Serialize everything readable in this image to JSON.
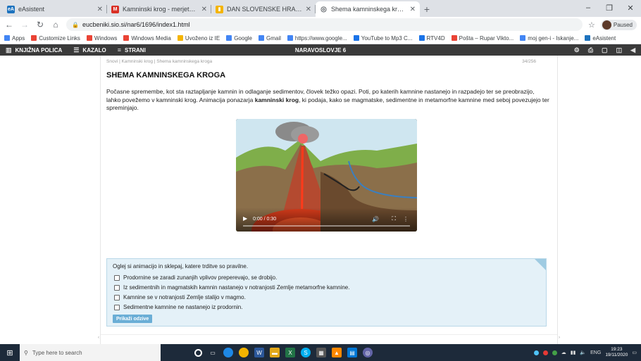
{
  "browser": {
    "tabs": [
      {
        "title": "eAsistent",
        "favicon_text": "eA",
        "favicon_color": "#1e73be",
        "active": false
      },
      {
        "title": "Kamninski krog - merjetka.rupar@",
        "favicon_text": "M",
        "favicon_color": "#d93025",
        "active": false
      },
      {
        "title": "DAN SLOVENSKE HRANE IN TRA",
        "favicon_text": "▮",
        "favicon_color": "#f4b400",
        "active": false
      },
      {
        "title": "Shema kamninskega kroga",
        "favicon_text": "◎",
        "favicon_color": "#5f6368",
        "active": true
      }
    ],
    "new_tab": "+",
    "window_controls": [
      "–",
      "❐",
      "✕"
    ],
    "address": "eucbeniki.sio.si/nar6/1696/index1.html",
    "profile_label": "Paused",
    "bookmarks": [
      {
        "label": "Apps",
        "color": "#4285f4"
      },
      {
        "label": "Customize Links",
        "color": "#ea4335"
      },
      {
        "label": "Windows",
        "color": "#ea4335"
      },
      {
        "label": "Windows Media",
        "color": "#ea4335"
      },
      {
        "label": "Uvoženo iz IE",
        "color": "#f4b400"
      },
      {
        "label": "Google",
        "color": "#4285f4"
      },
      {
        "label": "Gmail",
        "color": "#4285f4"
      },
      {
        "label": "https://www.google...",
        "color": "#4285f4"
      },
      {
        "label": "YouTube to Mp3 C...",
        "color": "#1a73e8"
      },
      {
        "label": "RTV4D",
        "color": "#1a73e8"
      },
      {
        "label": "Pošta – Rupar Vikto...",
        "color": "#ea4335"
      },
      {
        "label": "moj gen-i - Iskanje...",
        "color": "#4285f4"
      },
      {
        "label": "eAsistent",
        "color": "#1e73be"
      }
    ]
  },
  "ebook_bar": {
    "library": "KNJIŽNA POLICA",
    "contents": "KAZALO",
    "pages": "STRANI",
    "book_title": "NARAVOSLOVJE 6"
  },
  "page": {
    "breadcrumb": "Snovi | Kamninski krog | Shema kamninskega kroga",
    "page_number": "34/256",
    "title": "SHEMA KAMNINSKEGA KROGA",
    "paragraph_before": "Počasne spremembe, kot sta raztapljanje kamnin in odlaganje sedimentov, človek težko opazi. Poti, po katerih kamnine nastanejo in razpadejo ter se preobrazijo, lahko povežemo v kamninski krog. Animacija ponazarja ",
    "paragraph_bold": "kamninski krog",
    "paragraph_after": ", ki podaja, kako se magmatske, sedimentne in metamorfne kamnine med seboj povezujejo ter spreminjajo.",
    "video": {
      "play_icon": "▶",
      "time": "0:00 / 0:30",
      "progress": 0
    },
    "quiz": {
      "question": "Oglej si animacijo in sklepaj, katere trditve so pravilne.",
      "options": [
        "Prodornine se zaradi zunanjih vplivov preperevajo, se drobijo.",
        "Iz sedimentnih in magmatskih kamnin nastanejo v notranjosti Zemlje metamorfne kamnine.",
        "Kamnine se v notranjosti Zemlje stalijo v magmo.",
        "Sedimentne kamnine ne nastanejo iz prodornin."
      ],
      "submit_label": "Prikaži odzive"
    }
  },
  "taskbar": {
    "search_placeholder": "Type here to search",
    "lang": "ENG",
    "time": "19:23",
    "date": "19/11/2020"
  }
}
